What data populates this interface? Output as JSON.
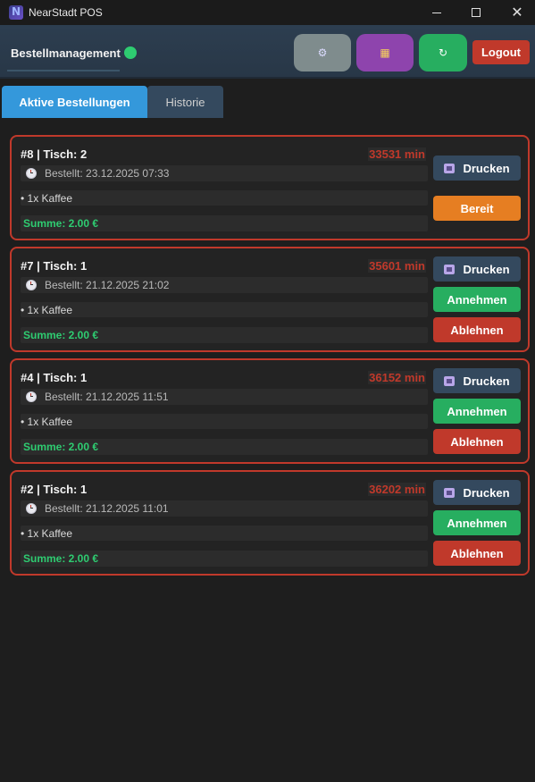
{
  "window": {
    "title": "NearStadt POS",
    "icon": "app-logo-icon",
    "controls": [
      "minimize-icon",
      "maximize-icon",
      "close-icon"
    ],
    "close_glyph": "✕"
  },
  "header": {
    "title": "Bestellmanagement",
    "status_color": "#2ecc71",
    "settings_glyph": "⚙",
    "calendar_glyph": "▦",
    "refresh_glyph": "↻",
    "logout_label": "Logout"
  },
  "tabs": [
    {
      "label": "Aktive Bestellungen",
      "active": true
    },
    {
      "label": "Historie",
      "active": false
    }
  ],
  "orders": [
    {
      "title": "#8 | Tisch: 2",
      "timer": "33531 min",
      "ordered": "Bestellt: 23.12.2025 07:33",
      "item": "• 1x Kaffee",
      "sum": "Summe: 2.00 €",
      "actions": [
        "Drucken",
        "Bereit"
      ]
    },
    {
      "title": "#7 | Tisch: 1",
      "timer": "35601 min",
      "ordered": "Bestellt: 21.12.2025 21:02",
      "item": "• 1x Kaffee",
      "sum": "Summe: 2.00 €",
      "actions": [
        "Drucken",
        "Annehmen",
        "Ablehnen"
      ]
    },
    {
      "title": "#4 | Tisch: 1",
      "timer": "36152 min",
      "ordered": "Bestellt: 21.12.2025 11:51",
      "item": "• 1x Kaffee",
      "sum": "Summe: 2.00 €",
      "actions": [
        "Drucken",
        "Annehmen",
        "Ablehnen"
      ]
    },
    {
      "title": "#2 | Tisch: 1",
      "timer": "36202 min",
      "ordered": "Bestellt: 21.12.2025 11:01",
      "item": "• 1x Kaffee",
      "sum": "Summe: 2.00 €",
      "actions": [
        "Drucken",
        "Annehmen",
        "Ablehnen"
      ]
    }
  ],
  "colors": {
    "accent": "#3498db",
    "danger": "#c0392b",
    "success": "#27ae60",
    "warning": "#e67e22",
    "header": "#2d3e50"
  }
}
